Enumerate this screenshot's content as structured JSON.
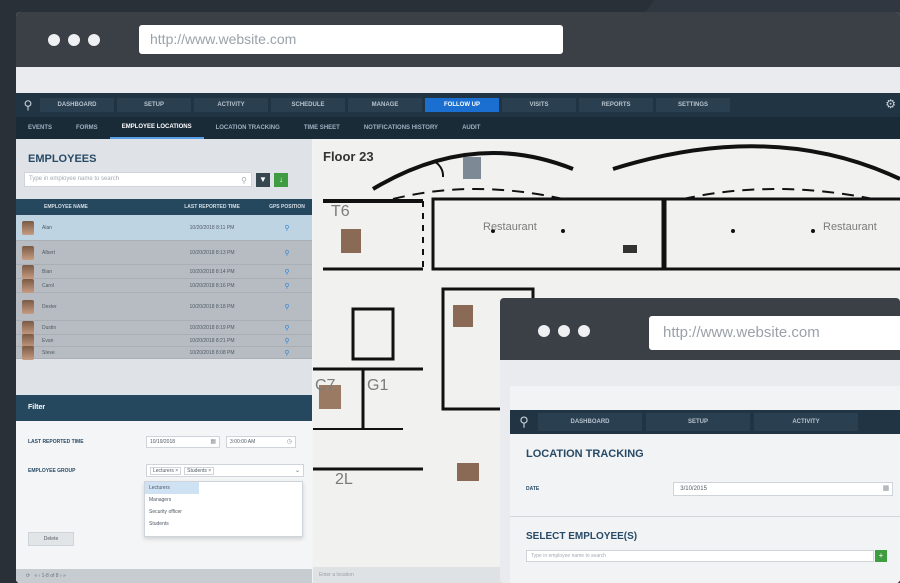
{
  "browser_back": {
    "url": "http://www.website.com"
  },
  "nav_main": [
    "DASHBOARD",
    "SETUP",
    "ACTIVITY",
    "SCHEDULE",
    "MANAGE",
    "FOLLOW UP",
    "VISITS",
    "REPORTS",
    "SETTINGS"
  ],
  "nav_main_active": "FOLLOW UP",
  "nav_sub": [
    "EVENTS",
    "FORMS",
    "EMPLOYEE LOCATIONS",
    "LOCATION TRACKING",
    "TIME SHEET",
    "NOTIFICATIONS HISTORY",
    "AUDIT"
  ],
  "nav_sub_active": "EMPLOYEE LOCATIONS",
  "employees": {
    "title": "EMPLOYEES",
    "search_placeholder": "Type in employee name to search",
    "columns": [
      "EMPLOYEE NAME",
      "LAST REPORTED TIME",
      "GPS POSITION"
    ],
    "rows": [
      {
        "name": "Alan",
        "time": "10/20/2018 8:11 PM"
      },
      {
        "name": "Albert",
        "time": "10/20/2018 8:13 PM"
      },
      {
        "name": "Bian",
        "time": "10/20/2018 8:14 PM"
      },
      {
        "name": "Carol",
        "time": "10/20/2018 8:16 PM"
      },
      {
        "name": "Dexter",
        "time": "10/20/2018 8:18 PM"
      },
      {
        "name": "Dustin",
        "time": "10/20/2018 8:19 PM"
      },
      {
        "name": "Evan",
        "time": "10/20/2018 8:21 PM"
      },
      {
        "name": "Steve",
        "time": "10/20/2018 8:08 PM"
      }
    ]
  },
  "filter": {
    "title": "Filter",
    "last_reported_label": "LAST REPORTED TIME",
    "date_value": "10/19/2018",
    "time_value": "3:00:00 AM",
    "group_label": "EMPLOYEE GROUP",
    "tags": [
      "Lecturers ×",
      "Students ×"
    ],
    "options": [
      "Lecturers",
      "Managers",
      "Security officer",
      "Students"
    ],
    "delete_label": "Delete",
    "pager": "1-8 of 8"
  },
  "map": {
    "floor_label": "Floor 23",
    "rooms": [
      "T6",
      "Restaurant",
      "Restaurant",
      "C7",
      "G1",
      "2L"
    ],
    "location_placeholder": "Enter a location"
  },
  "browser_front": {
    "url": "http://www.website.com",
    "nav": [
      "DASHBOARD",
      "SETUP",
      "ACTIVITY"
    ],
    "page_title": "LOCATION TRACKING",
    "date_label": "DATE",
    "date_value": "3/10/2015",
    "select_title": "SELECT EMPLOYEE(S)",
    "select_placeholder": "Type in employee name to search"
  }
}
